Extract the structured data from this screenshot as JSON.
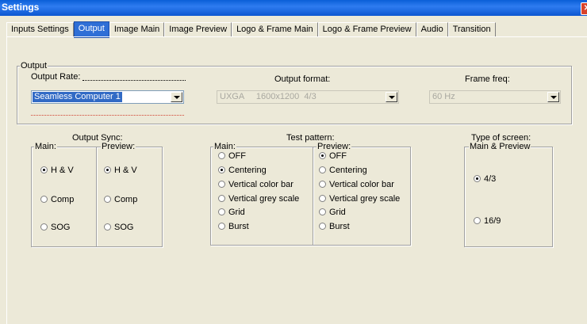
{
  "window": {
    "title": "Settings",
    "close_glyph": "✕"
  },
  "tabs": [
    {
      "label": "Inputs Settings",
      "active": false
    },
    {
      "label": "Output",
      "active": true
    },
    {
      "label": "Image Main",
      "active": false
    },
    {
      "label": "Image Preview",
      "active": false
    },
    {
      "label": "Logo & Frame Main",
      "active": false
    },
    {
      "label": "Logo & Frame Preview",
      "active": false
    },
    {
      "label": "Audio",
      "active": false
    },
    {
      "label": "Transition",
      "active": false
    }
  ],
  "output": {
    "group_label": "Output",
    "rate_label": "Output Rate:",
    "rate_combo": "Seamless Computer 1",
    "format_label": "Output format:",
    "format_combo": "UXGA     1600x1200  4/3",
    "freq_label": "Frame freq:",
    "freq_combo": "60 Hz"
  },
  "output_sync": {
    "title": "Output Sync:",
    "main_label": "Main:",
    "preview_label": "Preview:",
    "main_options": [
      {
        "label": "H & V",
        "checked": true
      },
      {
        "label": "Comp",
        "checked": false
      },
      {
        "label": "SOG",
        "checked": false
      }
    ],
    "preview_options": [
      {
        "label": "H & V",
        "checked": true
      },
      {
        "label": "Comp",
        "checked": false
      },
      {
        "label": "SOG",
        "checked": false
      }
    ]
  },
  "test_pattern": {
    "title": "Test pattern:",
    "main_label": "Main:",
    "preview_label": "Preview:",
    "main_options": [
      {
        "label": "OFF",
        "checked": false
      },
      {
        "label": "Centering",
        "checked": true
      },
      {
        "label": "Vertical color bar",
        "checked": false
      },
      {
        "label": "Vertical grey scale",
        "checked": false
      },
      {
        "label": "Grid",
        "checked": false
      },
      {
        "label": "Burst",
        "checked": false
      }
    ],
    "preview_options": [
      {
        "label": "OFF",
        "checked": true
      },
      {
        "label": "Centering",
        "checked": false
      },
      {
        "label": "Vertical color bar",
        "checked": false
      },
      {
        "label": "Vertical grey scale",
        "checked": false
      },
      {
        "label": "Grid",
        "checked": false
      },
      {
        "label": "Burst",
        "checked": false
      }
    ]
  },
  "screen_type": {
    "title": "Type of screen:",
    "group_label": "Main & Preview",
    "options": [
      {
        "label": "4/3",
        "checked": true
      },
      {
        "label": "16/9",
        "checked": false
      }
    ]
  }
}
